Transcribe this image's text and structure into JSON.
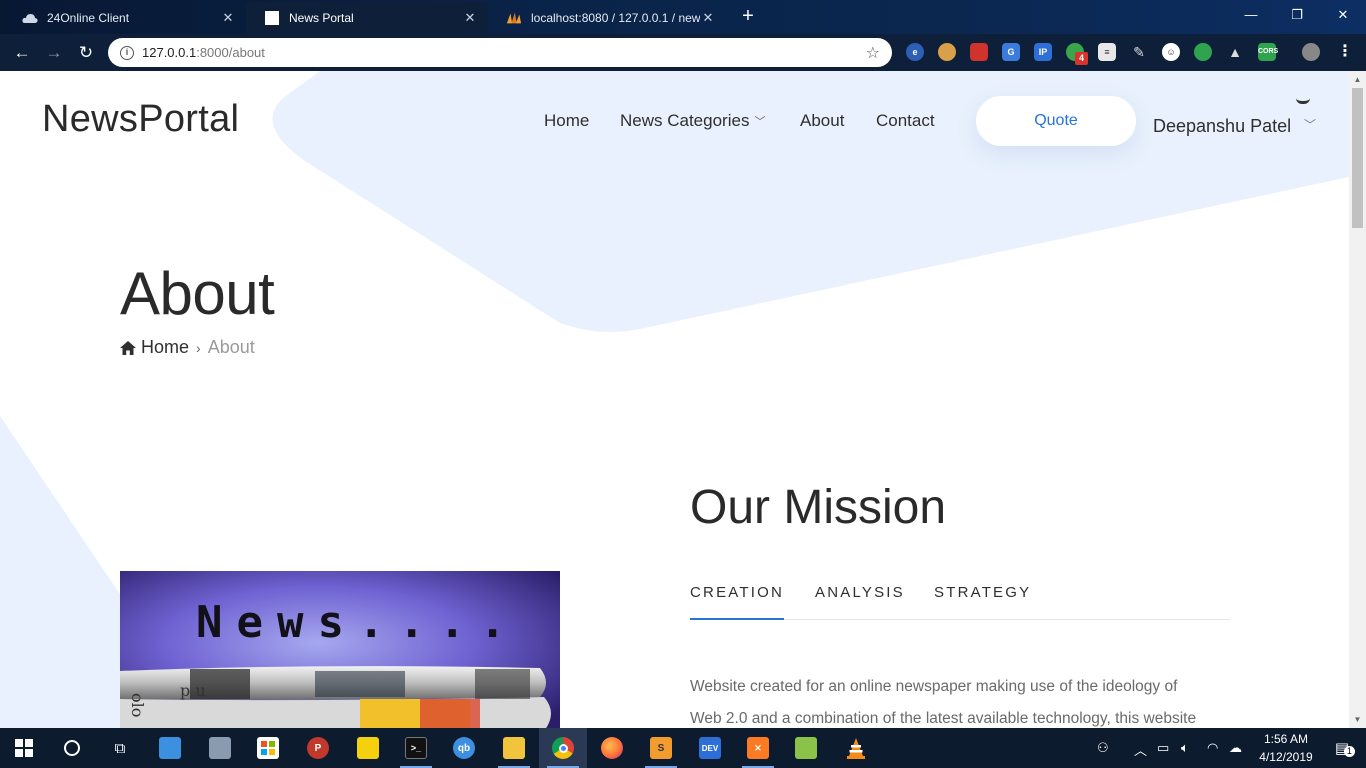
{
  "browser": {
    "tabs": [
      {
        "title": "24Online Client",
        "icon": "cloud-icon"
      },
      {
        "title": "News Portal",
        "icon": "blank-page-icon"
      },
      {
        "title": "localhost:8080 / 127.0.0.1 / news",
        "icon": "phpmyadmin-icon"
      }
    ],
    "url_host": "127.0.0.1",
    "url_path": ":8000/about",
    "extensions": [
      "ext-icon-1",
      "ext-icon-2",
      "ext-icon-3",
      "ext-icon-4",
      "ext-icon-5",
      "ext-icon-6",
      "ext-icon-7",
      "ext-icon-8",
      "ext-icon-9",
      "ext-icon-10",
      "ext-icon-11",
      "ext-icon-12"
    ],
    "extension_badge": "4",
    "extension_labels": {
      "ip": "IP",
      "cors": "CORS"
    }
  },
  "site": {
    "logo": "NewsPortal",
    "nav": {
      "home": "Home",
      "categories": "News Categories",
      "about": "About",
      "contact": "Contact"
    },
    "quote_button": "Quote",
    "user_name": "Deepanshu Patel"
  },
  "hero": {
    "title": "About",
    "breadcrumb_home": "Home",
    "breadcrumb_current": "About"
  },
  "mission": {
    "title": "Our Mission",
    "tabs": [
      "CREATION",
      "ANALYSIS",
      "STRATEGY"
    ],
    "active_tab": "CREATION",
    "paragraph_line1": "Website created for an online newspaper making use of the ideology of",
    "paragraph_line2": "Web 2.0 and a combination of the latest available technology, this website"
  },
  "news_image_text": "News....",
  "taskbar": {
    "time": "1:56 AM",
    "date": "4/12/2019",
    "notification_count": "1",
    "app_labels": {
      "qbittorrent": "qb",
      "dev": "DEV"
    }
  },
  "colors": {
    "accent": "#2674d6",
    "hero_bg": "#e8f1fd",
    "browser_frame": "#0e1f3a"
  }
}
